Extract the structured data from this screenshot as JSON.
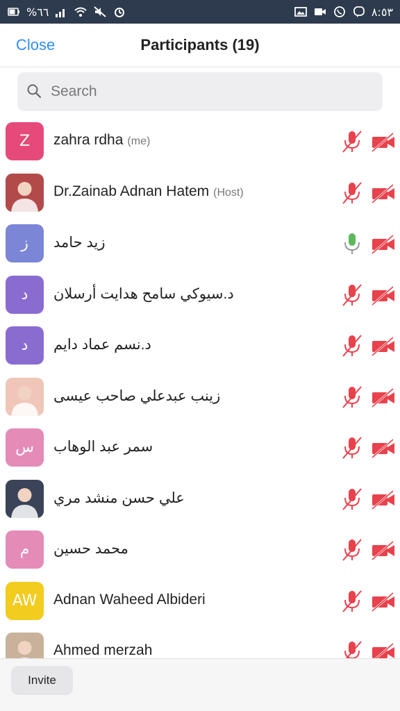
{
  "status_bar": {
    "battery_text": "%٦٦",
    "time": "٨:٥٣"
  },
  "header": {
    "close_label": "Close",
    "title": "Participants (19)"
  },
  "search": {
    "placeholder": "Search",
    "value": ""
  },
  "participants": [
    {
      "initials": "Z",
      "name": "zahra rdha",
      "tag": "(me)",
      "avatar_color": "#e64a7b",
      "avatar_kind": "initials",
      "mic": "muted",
      "video": "off"
    },
    {
      "initials": "",
      "name": "Dr.Zainab Adnan Hatem",
      "tag": "(Host)",
      "avatar_color": "#b24a4a",
      "avatar_kind": "photo",
      "mic": "muted",
      "video": "off"
    },
    {
      "initials": "ز",
      "name": "زيد حامد",
      "tag": "",
      "avatar_color": "#7b86d6",
      "avatar_kind": "initials",
      "mic": "on",
      "video": "off"
    },
    {
      "initials": "د",
      "name": "د.سيوكي سامح هدايت أرسلان",
      "tag": "",
      "avatar_color": "#8a6cd1",
      "avatar_kind": "initials",
      "mic": "muted",
      "video": "off"
    },
    {
      "initials": "د",
      "name": "د.نسم عماد دايم",
      "tag": "",
      "avatar_color": "#8a6cd1",
      "avatar_kind": "initials",
      "mic": "muted",
      "video": "off"
    },
    {
      "initials": "",
      "name": "زينب عبدعلي صاحب عيسى",
      "tag": "",
      "avatar_color": "#f0c6b8",
      "avatar_kind": "photo",
      "mic": "muted",
      "video": "off"
    },
    {
      "initials": "س",
      "name": "سمر عبد الوهاب",
      "tag": "",
      "avatar_color": "#e48bb8",
      "avatar_kind": "initials",
      "mic": "muted",
      "video": "off"
    },
    {
      "initials": "",
      "name": "علي حسن منشد مري",
      "tag": "",
      "avatar_color": "#3a4358",
      "avatar_kind": "photo",
      "mic": "muted",
      "video": "off"
    },
    {
      "initials": "م",
      "name": "محمد حسين",
      "tag": "",
      "avatar_color": "#e48bb8",
      "avatar_kind": "initials",
      "mic": "muted",
      "video": "off"
    },
    {
      "initials": "AW",
      "name": "Adnan Waheed Albideri",
      "tag": "",
      "avatar_color": "#f2cc1f",
      "avatar_kind": "initials",
      "mic": "muted",
      "video": "off"
    },
    {
      "initials": "",
      "name": "Ahmed merzah",
      "tag": "",
      "avatar_color": "#c9b29a",
      "avatar_kind": "photo",
      "mic": "muted",
      "video": "off"
    }
  ],
  "footer": {
    "invite_label": "Invite"
  },
  "colors": {
    "accent": "#2d8cff",
    "muted_red": "#e8424c",
    "mic_on_green": "#5cb85c"
  }
}
